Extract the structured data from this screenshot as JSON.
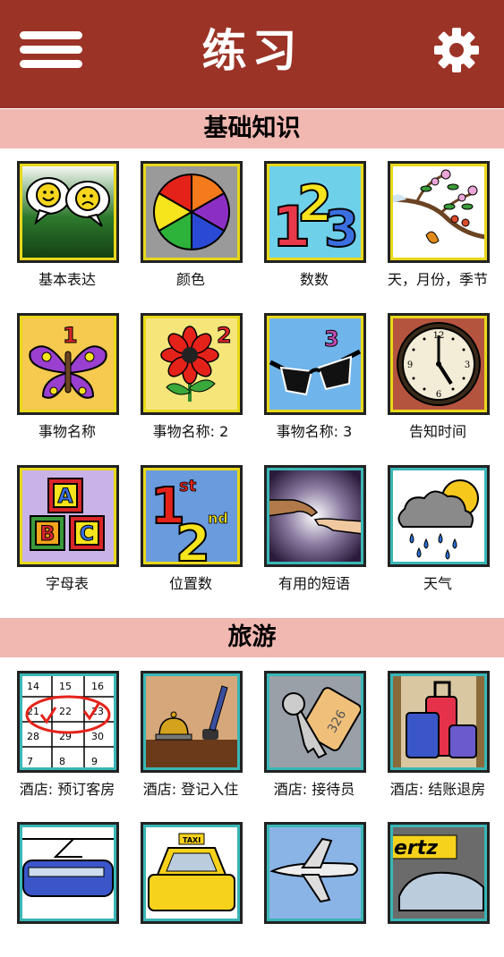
{
  "header": {
    "title": "练习"
  },
  "sections": [
    {
      "title": "基础知识"
    },
    {
      "title": "旅游"
    }
  ],
  "tiles": [
    {
      "label": "基本表达",
      "icon": "speech-faces-icon"
    },
    {
      "label": "颜色",
      "icon": "color-wheel-icon"
    },
    {
      "label": "数数",
      "icon": "numbers-123-icon"
    },
    {
      "label": "天，月份，季节",
      "icon": "seasons-branch-icon"
    },
    {
      "label": "事物名称",
      "icon": "butterfly-icon"
    },
    {
      "label": "事物名称: 2",
      "icon": "flower-icon"
    },
    {
      "label": "事物名称: 3",
      "icon": "sunglasses-icon"
    },
    {
      "label": "告知时间",
      "icon": "clock-icon"
    },
    {
      "label": "字母表",
      "icon": "abc-blocks-icon"
    },
    {
      "label": "位置数",
      "icon": "ordinal-numbers-icon"
    },
    {
      "label": "有用的短语",
      "icon": "handshake-icon"
    },
    {
      "label": "天气",
      "icon": "weather-icon"
    },
    {
      "label": "酒店: 预订客房",
      "icon": "calendar-icon"
    },
    {
      "label": "酒店: 登记入住",
      "icon": "reception-bell-icon"
    },
    {
      "label": "酒店: 接待员",
      "icon": "room-key-icon"
    },
    {
      "label": "酒店: 结账退房",
      "icon": "luggage-icon"
    },
    {
      "label": "",
      "icon": "train-icon"
    },
    {
      "label": "",
      "icon": "taxi-icon"
    },
    {
      "label": "",
      "icon": "airplane-icon"
    },
    {
      "label": "",
      "icon": "car-rental-icon"
    }
  ],
  "calendar_days": [
    "14",
    "15",
    "16",
    "21",
    "22",
    "23",
    "28",
    "29",
    "30",
    "7",
    "8",
    "9"
  ],
  "key_tag": "326",
  "rental_sign": "ertz",
  "taxi_sign": "TAXI",
  "ordinals": {
    "first": "1",
    "first_suffix": "st",
    "second": "2",
    "second_suffix": "nd"
  },
  "number_badges": {
    "butterfly": "1",
    "flower": "2",
    "sunglasses": "3"
  },
  "alphabet": [
    "A",
    "B",
    "C"
  ],
  "counting": [
    "1",
    "2",
    "3"
  ],
  "colors": {
    "header": "#9b3326",
    "section_bar": "#f1b7b1",
    "frame_yellow": "#e8d81a",
    "frame_teal": "#3ab6b6"
  }
}
